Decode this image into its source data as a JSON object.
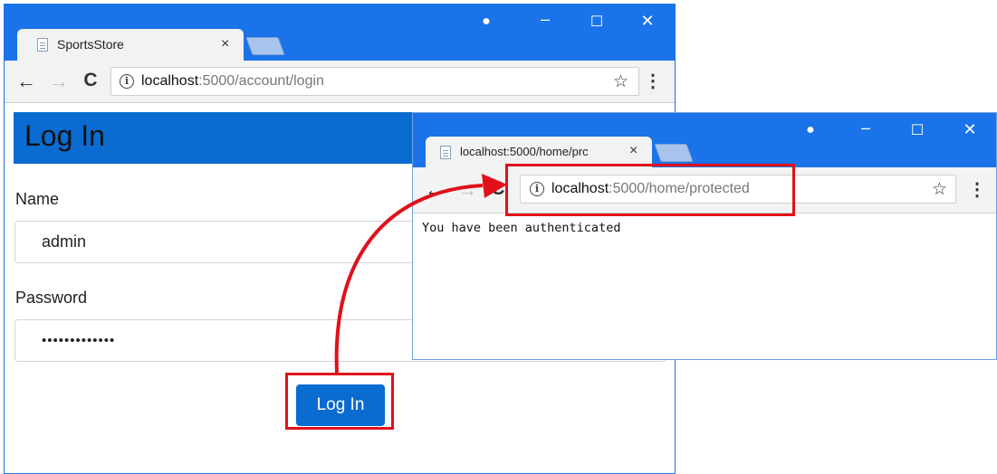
{
  "login_window": {
    "tab_title": "SportsStore",
    "tab_close": "×",
    "url_host": "localhost",
    "url_rest": ":5000/account/login",
    "controls": {
      "profile": "●",
      "minimize": "–",
      "maximize": "☐",
      "close": "✕"
    },
    "nav": {
      "back": "←",
      "forward": "→",
      "reload": "C",
      "info": "i",
      "star": "☆",
      "menu": "⋮"
    },
    "page": {
      "heading": "Log In",
      "name_label": "Name",
      "name_value": "admin",
      "password_label": "Password",
      "password_value": "•••••••••••••",
      "login_button": "Log In"
    }
  },
  "protected_window": {
    "tab_title": "localhost:5000/home/prc",
    "tab_close": "×",
    "url_host": "localhost",
    "url_rest": ":5000/home/protected",
    "controls": {
      "profile": "●",
      "minimize": "–",
      "maximize": "☐",
      "close": "✕"
    },
    "nav": {
      "back": "←",
      "forward": "→",
      "reload": "C",
      "info": "i",
      "star": "☆",
      "menu": "⋮"
    },
    "page": {
      "message": "You have been authenticated"
    }
  },
  "annotation": {
    "highlight_color": "#e0101b"
  }
}
